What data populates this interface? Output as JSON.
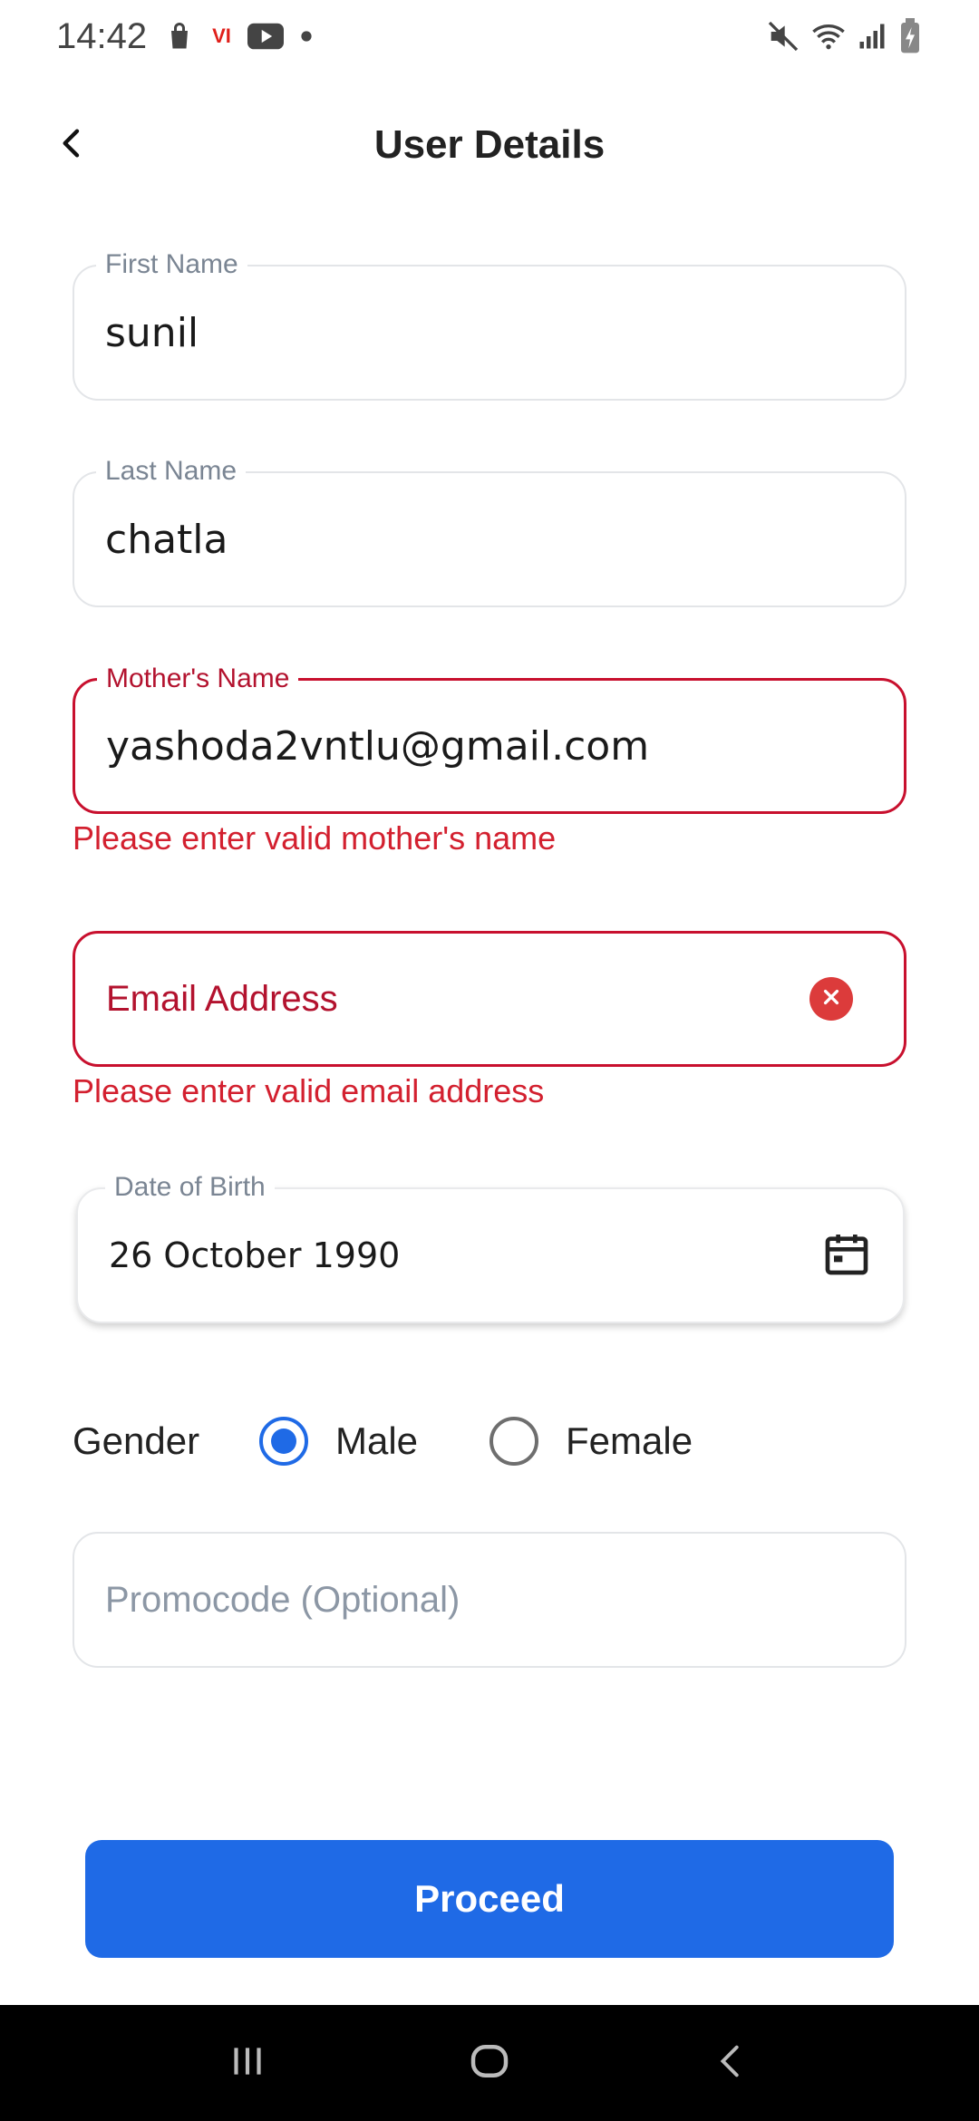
{
  "status_bar": {
    "time": "14:42",
    "carrier_badge": "VI",
    "icons": [
      "shopping-bag-icon",
      "vi-carrier-icon",
      "youtube-icon",
      "dot-icon",
      "mute-icon",
      "wifi-icon",
      "signal-icon",
      "battery-charging-icon"
    ]
  },
  "header": {
    "title": "User Details",
    "back_icon": "chevron-left-icon"
  },
  "form": {
    "first_name": {
      "label": "First Name",
      "value": "sunil"
    },
    "last_name": {
      "label": "Last Name",
      "value": "chatla"
    },
    "mothers_name": {
      "label": "Mother's Name",
      "value": "yashoda2vntlu@gmail.com",
      "error": "Please enter valid mother's name"
    },
    "email": {
      "placeholder": "Email Address",
      "error": "Please enter valid email address",
      "clear_icon": "clear-icon"
    },
    "dob": {
      "label": "Date of Birth",
      "value": "26 October 1990",
      "icon": "calendar-icon"
    },
    "gender": {
      "label": "Gender",
      "options": [
        {
          "label": "Male",
          "selected": true
        },
        {
          "label": "Female",
          "selected": false
        }
      ]
    },
    "promocode": {
      "placeholder": "Promocode (Optional)"
    }
  },
  "actions": {
    "proceed_label": "Proceed"
  },
  "colors": {
    "primary": "#1f6ae6",
    "error": "#c8102e",
    "error_text": "#d3202f",
    "nav_bar": "#000000"
  },
  "nav_bar": {
    "icons": [
      "recents-icon",
      "home-icon",
      "back-icon"
    ]
  }
}
